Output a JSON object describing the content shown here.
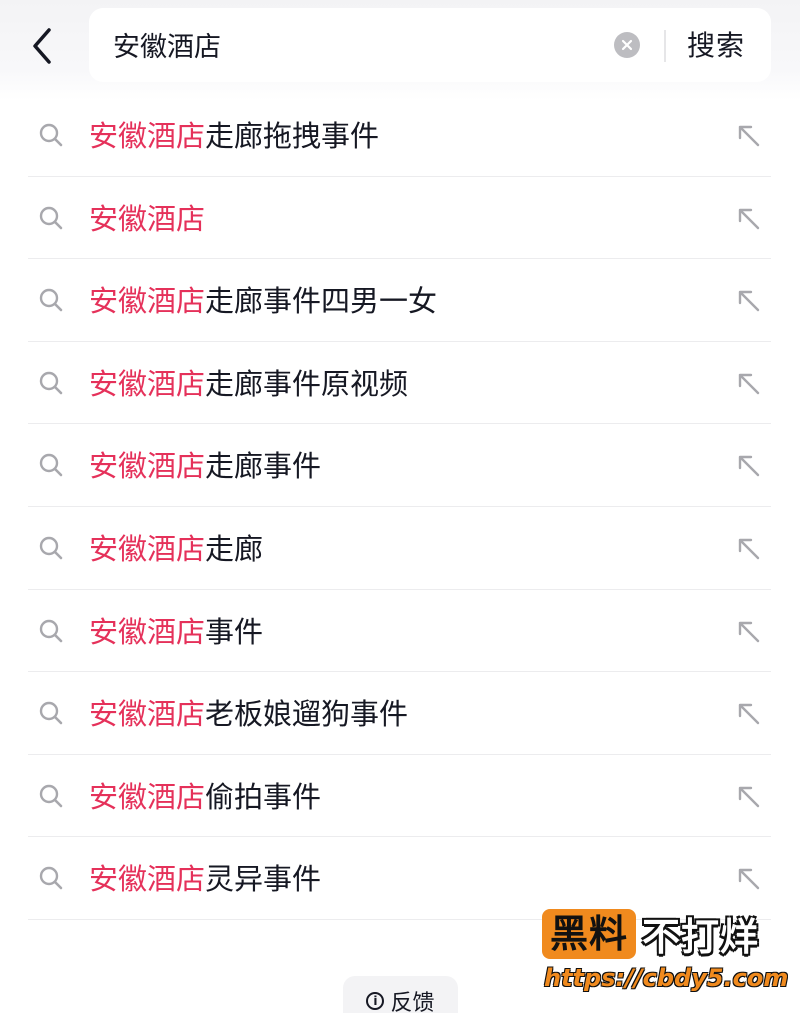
{
  "search": {
    "query": "安徽酒店",
    "button_label": "搜索"
  },
  "suggestions": [
    {
      "highlight": "安徽酒店",
      "rest": "走廊拖拽事件"
    },
    {
      "highlight": "安徽酒店",
      "rest": ""
    },
    {
      "highlight": "安徽酒店",
      "rest": "走廊事件四男一女"
    },
    {
      "highlight": "安徽酒店",
      "rest": "走廊事件原视频"
    },
    {
      "highlight": "安徽酒店",
      "rest": "走廊事件"
    },
    {
      "highlight": "安徽酒店",
      "rest": "走廊"
    },
    {
      "highlight": "安徽酒店",
      "rest": "事件"
    },
    {
      "highlight": "安徽酒店",
      "rest": "老板娘遛狗事件"
    },
    {
      "highlight": "安徽酒店",
      "rest": "偷拍事件"
    },
    {
      "highlight": "安徽酒店",
      "rest": "灵异事件"
    }
  ],
  "feedback": {
    "label": "反馈"
  },
  "watermark": {
    "boxed": "黑料",
    "rest": "不打烊",
    "url": "https://cbdy5.com"
  },
  "colors": {
    "highlight": "#e5315a",
    "icon_gray": "#a8a8ad",
    "watermark_orange": "#f08a1e"
  },
  "icons": {
    "back": "chevron-left-icon",
    "clear": "clear-icon",
    "search": "search-icon",
    "fill": "arrow-up-left-icon",
    "info": "info-icon"
  }
}
